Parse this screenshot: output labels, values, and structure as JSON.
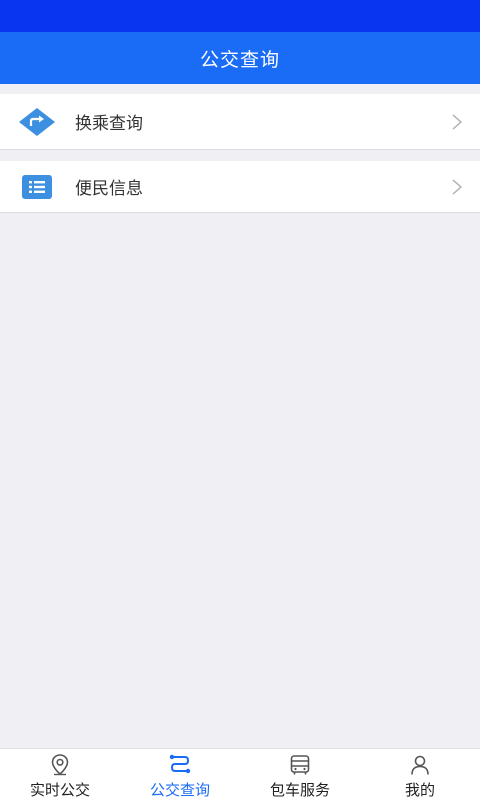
{
  "header": {
    "title": "公交查询"
  },
  "menu": {
    "items": [
      {
        "label": "换乘查询",
        "icon": "transfer-route-icon"
      },
      {
        "label": "便民信息",
        "icon": "list-icon"
      }
    ]
  },
  "tabs": [
    {
      "label": "实时公交",
      "icon": "location-pin-icon",
      "active": false
    },
    {
      "label": "公交查询",
      "icon": "route-icon",
      "active": true
    },
    {
      "label": "包车服务",
      "icon": "bus-icon",
      "active": false
    },
    {
      "label": "我的",
      "icon": "user-icon",
      "active": false
    }
  ],
  "colors": {
    "status_bar": "#0a35f0",
    "header": "#1a6cf6",
    "accent": "#1a6cf6",
    "icon_blue": "#3d8fe0",
    "background": "#efeff4"
  }
}
